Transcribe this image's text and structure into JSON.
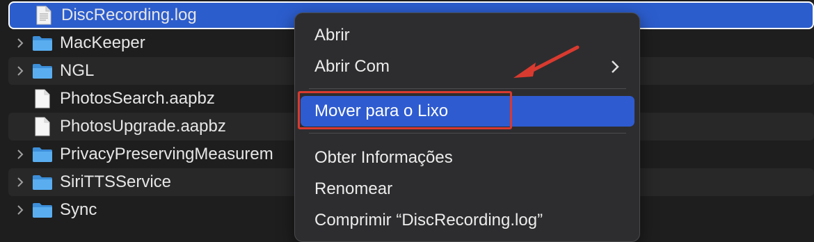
{
  "files": [
    {
      "name": "DiscRecording.log",
      "type": "file",
      "expandable": false,
      "selected": true
    },
    {
      "name": "MacKeeper",
      "type": "folder",
      "expandable": true
    },
    {
      "name": "NGL",
      "type": "folder",
      "expandable": true
    },
    {
      "name": "PhotosSearch.aapbz",
      "type": "file",
      "expandable": false
    },
    {
      "name": "PhotosUpgrade.aapbz",
      "type": "file",
      "expandable": false
    },
    {
      "name": "PrivacyPreservingMeasurem",
      "type": "folder",
      "expandable": true
    },
    {
      "name": "SiriTTSService",
      "type": "folder",
      "expandable": true
    },
    {
      "name": "Sync",
      "type": "folder",
      "expandable": true
    }
  ],
  "context_menu": {
    "open": "Abrir",
    "open_with": "Abrir Com",
    "move_to_trash": "Mover para o Lixo",
    "get_info": "Obter Informações",
    "rename": "Renomear",
    "compress": "Comprimir “DiscRecording.log”"
  },
  "colors": {
    "selection": "#2c5dcd",
    "menu_highlight": "#2e5bd0",
    "annotation": "#d93a2f",
    "folder": "#4fa3e8"
  },
  "icons": {
    "chevron": "chevron-right-icon",
    "folder": "folder-icon",
    "file": "document-icon",
    "submenu": "chevron-right-icon"
  }
}
